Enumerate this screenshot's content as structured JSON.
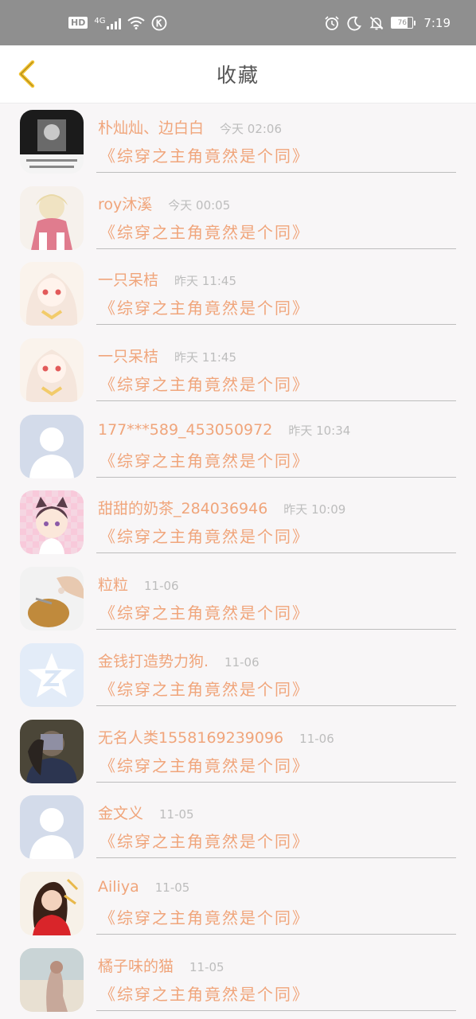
{
  "status_bar": {
    "network": "4G",
    "battery": "76",
    "battery_level": 0.76,
    "time": "7:19"
  },
  "header": {
    "title": "收藏"
  },
  "colors": {
    "accent": "#f0a57b",
    "back_icon": "#f2c230",
    "status_bar": "#8f8f8f"
  },
  "items": [
    {
      "name": "朴灿灿、边白白",
      "time": "今天 02:06",
      "book": "《综穿之主角竟然是个同》",
      "avatar": "dark-photo-avatar"
    },
    {
      "name": "roy沐溪",
      "time": "今天 00:05",
      "book": "《综穿之主角竟然是个同》",
      "avatar": "pink-girl-avatar"
    },
    {
      "name": "一只呆桔",
      "time": "昨天 11:45",
      "book": "《综穿之主角竟然是个同》",
      "avatar": "anime-girl-avatar"
    },
    {
      "name": "一只呆桔",
      "time": "昨天 11:45",
      "book": "《综穿之主角竟然是个同》",
      "avatar": "anime-girl-avatar"
    },
    {
      "name": "177***589_453050972",
      "time": "昨天 10:34",
      "book": "《综穿之主角竟然是个同》",
      "avatar": "default-avatar"
    },
    {
      "name": "甜甜的奶茶_284036946",
      "time": "昨天 10:09",
      "book": "《综穿之主角竟然是个同》",
      "avatar": "catgirl-avatar"
    },
    {
      "name": "粒粒",
      "time": "11-06",
      "book": "《综穿之主角竟然是个同》",
      "avatar": "bread-photo-avatar"
    },
    {
      "name": "金钱打造势力狗.",
      "time": "11-06",
      "book": "《综穿之主角竟然是个同》",
      "avatar": "qzone-star-avatar"
    },
    {
      "name": "无名人类1558169239096",
      "time": "11-06",
      "book": "《综穿之主角竟然是个同》",
      "avatar": "portrait-photo-avatar"
    },
    {
      "name": "金文义",
      "time": "11-05",
      "book": "《综穿之主角竟然是个同》",
      "avatar": "default-avatar"
    },
    {
      "name": "Ailiya",
      "time": "11-05",
      "book": "《综穿之主角竟然是个同》",
      "avatar": "red-girl-avatar"
    },
    {
      "name": "橘子味的猫",
      "time": "11-05",
      "book": "《综穿之主角竟然是个同》",
      "avatar": "soft-photo-avatar"
    }
  ]
}
